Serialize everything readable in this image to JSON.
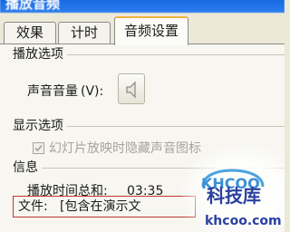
{
  "window": {
    "title": "播放音频"
  },
  "tabs": [
    {
      "label": "效果"
    },
    {
      "label": "计时"
    },
    {
      "label": "音频设置"
    }
  ],
  "playback": {
    "section_title": "播放选项",
    "volume_label": "声音音量",
    "volume_shortcut": "(V):",
    "volume_icon": "speaker-icon"
  },
  "display": {
    "section_title": "显示选项",
    "hide_label": "幻灯片放映时隐藏声音图标"
  },
  "info": {
    "section_title": "信息",
    "total_time_label": "播放时间总和:",
    "total_time_value": "03:35",
    "file_label": "文件:",
    "file_value": "[包含在演示文"
  },
  "watermark": {
    "logo": "KHCOO",
    "brand": "科技库",
    "domain": "khcoo.com"
  }
}
